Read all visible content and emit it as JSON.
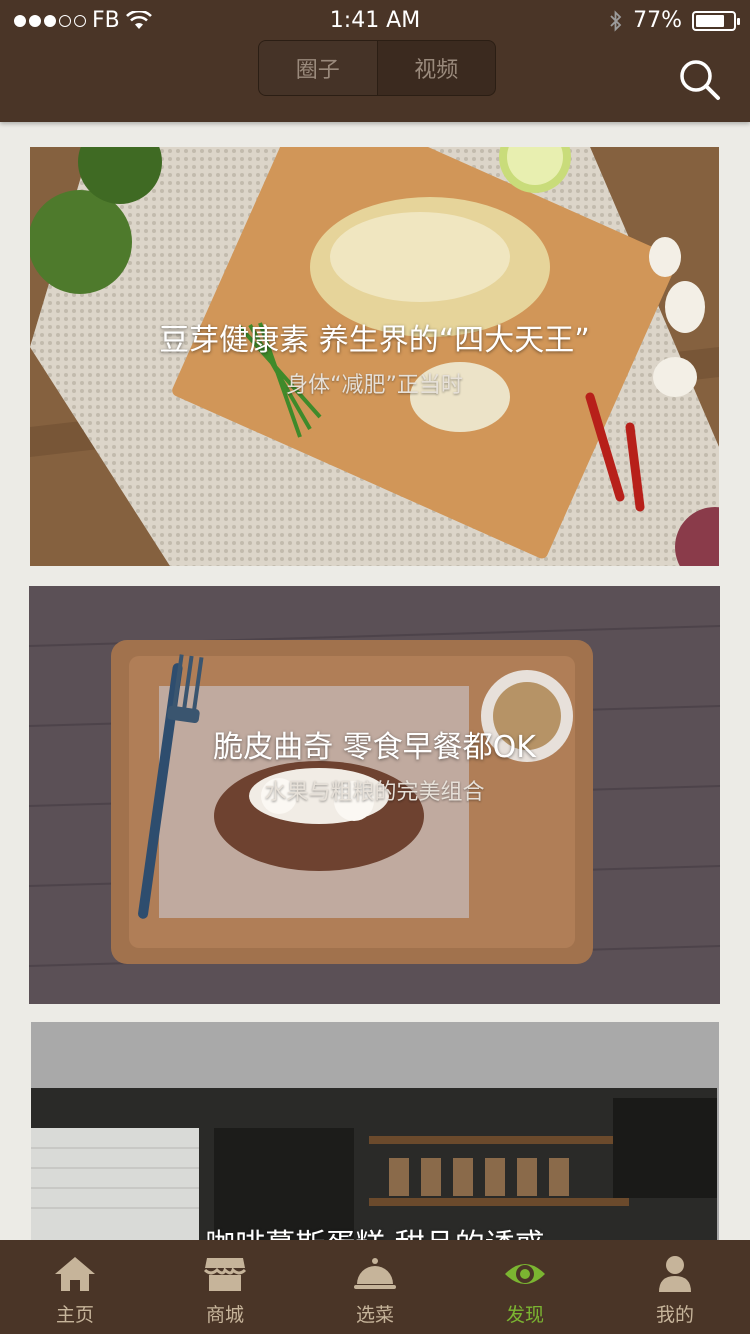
{
  "status_bar": {
    "carrier": "FB",
    "time": "1:41 AM",
    "battery": "77%"
  },
  "header": {
    "tabs": [
      {
        "label": "圈子",
        "active": true
      },
      {
        "label": "视频",
        "active": false
      }
    ],
    "search_icon": "search-icon"
  },
  "cards": [
    {
      "title": "豆芽健康素 养生界的“四大天王”",
      "subtitle": "身体“减肥”正当时"
    },
    {
      "title": "脆皮曲奇 零食早餐都OK",
      "subtitle": "水果与粗粮的完美组合"
    },
    {
      "title": "咖啡慕斯蛋糕 甜品的诱惑",
      "subtitle": ""
    }
  ],
  "tabbar": {
    "items": [
      {
        "label": "主页",
        "icon": "home-icon",
        "active": false
      },
      {
        "label": "商城",
        "icon": "shop-icon",
        "active": false
      },
      {
        "label": "选菜",
        "icon": "cloche-icon",
        "active": false
      },
      {
        "label": "发现",
        "icon": "eye-icon",
        "active": true
      },
      {
        "label": "我的",
        "icon": "user-icon",
        "active": false
      }
    ]
  },
  "colors": {
    "header_bg": "#4a3527",
    "tab_inactive": "#c6b49a",
    "tab_active": "#7bb531",
    "page_bg": "#ecebe6"
  }
}
